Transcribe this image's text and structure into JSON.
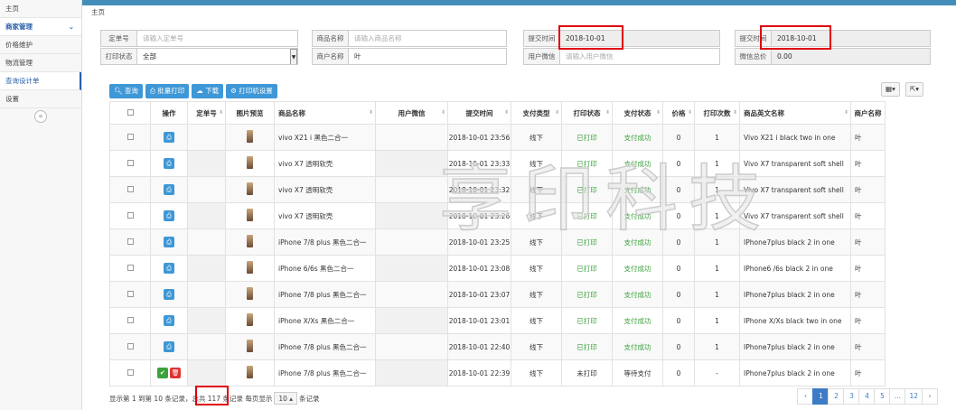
{
  "sidebar": {
    "items": [
      {
        "label": "主页"
      },
      {
        "label": "商家管理",
        "chevron": "chevron-down-icon"
      },
      {
        "label": "价格维护"
      },
      {
        "label": "物流管理"
      },
      {
        "label": "查询设计单"
      },
      {
        "label": "设置"
      }
    ],
    "collapse_icon": "double-chevron-left-icon"
  },
  "breadcrumb": "主页",
  "filters": {
    "order_no": {
      "label": "定单号",
      "placeholder": "请输入定单号"
    },
    "product_name": {
      "label": "商品名称",
      "placeholder": "请输入商品名称"
    },
    "submit_time_1": {
      "label": "提交时间",
      "value": "2018-10-01"
    },
    "submit_time_2": {
      "label": "提交时间",
      "value": "2018-10-01"
    },
    "print_status": {
      "label": "打印状态",
      "value": "全部"
    },
    "merchant_name": {
      "label": "商户名称",
      "value": "叶"
    },
    "user_wechat": {
      "label": "用户微信",
      "placeholder": "请输入用户微信"
    },
    "wechat_total": {
      "label": "微信总价",
      "value": "0.00"
    }
  },
  "toolbar": {
    "query": "查询",
    "batch_print": "批量打印",
    "download": "下载",
    "printer_settings": "打印机设置",
    "columns_icon": "grid-icon",
    "export_icon": "export-icon"
  },
  "table": {
    "headers": [
      "操作",
      "定单号",
      "图片预览",
      "商品名称",
      "用户微信",
      "提交时间",
      "支付类型",
      "打印状态",
      "支付状态",
      "价格",
      "打印次数",
      "商品英文名称",
      "商户名称"
    ],
    "rows": [
      {
        "name": "vivo X21 i 黑色二合一",
        "time": "2018-10-01 23:56",
        "pay_type": "线下",
        "print_status": "已打印",
        "pay_status": "支付成功",
        "price": "0",
        "count": "1",
        "en_name": "Vivo X21 i black two in one",
        "merchant": "叶"
      },
      {
        "name": "vivo X7 透明软壳",
        "time": "2018-10-01 23:33",
        "pay_type": "线下",
        "print_status": "已打印",
        "pay_status": "支付成功",
        "price": "0",
        "count": "1",
        "en_name": "Vivo X7 transparent soft shell",
        "merchant": "叶"
      },
      {
        "name": "vivo X7 透明软壳",
        "time": "2018-10-01 23:32",
        "pay_type": "线下",
        "print_status": "已打印",
        "pay_status": "支付成功",
        "price": "0",
        "count": "1",
        "en_name": "Vivo X7 transparent soft shell",
        "merchant": "叶"
      },
      {
        "name": "vivo X7 透明软壳",
        "time": "2018-10-01 23:26",
        "pay_type": "线下",
        "print_status": "已打印",
        "pay_status": "支付成功",
        "price": "0",
        "count": "1",
        "en_name": "Vivo X7 transparent soft shell",
        "merchant": "叶"
      },
      {
        "name": "iPhone 7/8 plus 黑色二合一",
        "time": "2018-10-01 23:25",
        "pay_type": "线下",
        "print_status": "已打印",
        "pay_status": "支付成功",
        "price": "0",
        "count": "1",
        "en_name": "IPhone7plus black 2 in one",
        "merchant": "叶"
      },
      {
        "name": "iPhone 6/6s 黑色二合一",
        "time": "2018-10-01 23:08",
        "pay_type": "线下",
        "print_status": "已打印",
        "pay_status": "支付成功",
        "price": "0",
        "count": "1",
        "en_name": "IPhone6 /6s black 2 in one",
        "merchant": "叶"
      },
      {
        "name": "iPhone 7/8 plus 黑色二合一",
        "time": "2018-10-01 23:07",
        "pay_type": "线下",
        "print_status": "已打印",
        "pay_status": "支付成功",
        "price": "0",
        "count": "1",
        "en_name": "IPhone7plus black 2 in one",
        "merchant": "叶"
      },
      {
        "name": "iPhone X/Xs 黑色二合一",
        "time": "2018-10-01 23:01",
        "pay_type": "线下",
        "print_status": "已打印",
        "pay_status": "支付成功",
        "price": "0",
        "count": "1",
        "en_name": "IPhone X/Xs black two in one",
        "merchant": "叶"
      },
      {
        "name": "iPhone 7/8 plus 黑色二合一",
        "time": "2018-10-01 22:40",
        "pay_type": "线下",
        "print_status": "已打印",
        "pay_status": "支付成功",
        "price": "0",
        "count": "1",
        "en_name": "IPhone7plus black 2 in one",
        "merchant": "叶"
      },
      {
        "name": "iPhone 7/8 plus 黑色二合一",
        "time": "2018-10-01 22:39",
        "pay_type": "线下",
        "print_status": "未打印",
        "pay_status": "等待支付",
        "price": "0",
        "count": "-",
        "en_name": "IPhone7plus black 2 in one",
        "merchant": "叶"
      }
    ]
  },
  "watermark": "享印科技",
  "footer": {
    "summary_a": "显示第 1 到第 10 条记录，总共 117 条记录 每页显示",
    "page_size": "10",
    "summary_b": "条记录"
  },
  "pagination": [
    "‹",
    "1",
    "2",
    "3",
    "4",
    "5",
    "...",
    "12",
    "›"
  ],
  "colors": {
    "accent": "#3e97d6",
    "success": "#3da23d",
    "highlight": "#e0000a"
  }
}
